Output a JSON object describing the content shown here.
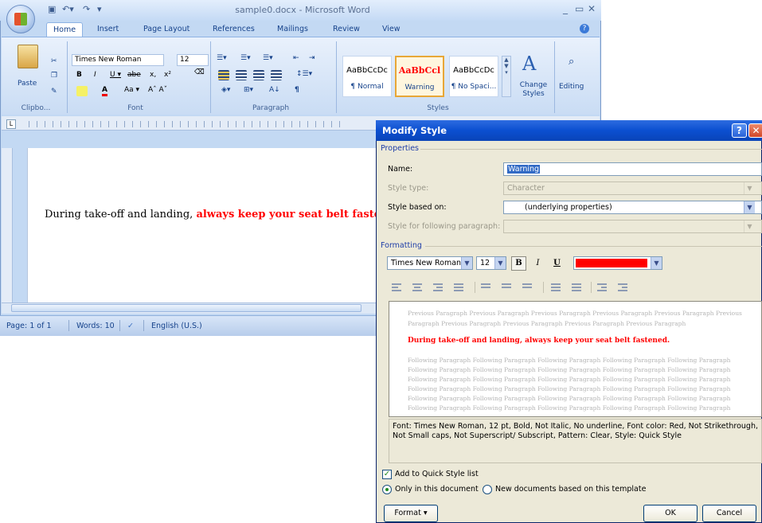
{
  "word": {
    "title": "sample0.docx - Microsoft Word",
    "tabs": [
      "Home",
      "Insert",
      "Page Layout",
      "References",
      "Mailings",
      "Review",
      "View"
    ],
    "font_name": "Times New Roman",
    "font_size": "12",
    "paste_label": "Paste",
    "groups": [
      "Clipbo...",
      "Font",
      "Paragraph",
      "Styles"
    ],
    "styles": [
      {
        "sample": "AaBbCcDc",
        "name": "¶ Normal"
      },
      {
        "sample": "AaBbCcl",
        "name": "Warning"
      },
      {
        "sample": "AaBbCcDc",
        "name": "¶ No Spaci..."
      }
    ],
    "change_styles": "Change Styles",
    "editing": "Editing",
    "document_text_plain": "During take-off and landing, ",
    "document_text_bold": "always keep your seat belt fastened.",
    "status": {
      "page": "Page: 1 of 1",
      "words": "Words: 10",
      "language": "English (U.S.)"
    }
  },
  "dialog": {
    "title": "Modify Style",
    "properties_label": "Properties",
    "name_label": "Name:",
    "name_value": "Warning",
    "style_type_label": "Style type:",
    "style_type_value": "Character",
    "based_on_label": "Style based on:",
    "based_on_value": "(underlying properties)",
    "following_label": "Style for following paragraph:",
    "formatting_label": "Formatting",
    "font_name": "Times New Roman",
    "font_size": "12",
    "bold": "B",
    "italic": "I",
    "underline": "U",
    "font_color": "#ff0000",
    "preview": {
      "previous": [
        "Previous Paragraph Previous Paragraph Previous Paragraph Previous Paragraph Previous Paragraph Previous",
        "Paragraph Previous Paragraph Previous Paragraph Previous Paragraph Previous Paragraph"
      ],
      "sample": "During take-off and landing, always keep your seat belt fastened.",
      "following": [
        "Following Paragraph Following Paragraph Following Paragraph Following Paragraph Following Paragraph",
        "Following Paragraph Following Paragraph Following Paragraph Following Paragraph Following Paragraph",
        "Following Paragraph Following Paragraph Following Paragraph Following Paragraph Following Paragraph",
        "Following Paragraph Following Paragraph Following Paragraph Following Paragraph Following Paragraph",
        "Following Paragraph Following Paragraph Following Paragraph Following Paragraph Following Paragraph",
        "Following Paragraph Following Paragraph Following Paragraph Following Paragraph Following Paragraph"
      ]
    },
    "description": "Font: Times New Roman, 12 pt, Bold, Not Italic, No underline, Font color: Red, Not Strikethrough, Not Small caps, Not Superscript/ Subscript, Pattern: Clear, Style: Quick Style",
    "add_quick_style": "Add to Quick Style list",
    "only_this_doc": "Only in this document",
    "new_docs": "New documents based on this template",
    "format_button": "Format ▾",
    "ok": "OK",
    "cancel": "Cancel"
  }
}
